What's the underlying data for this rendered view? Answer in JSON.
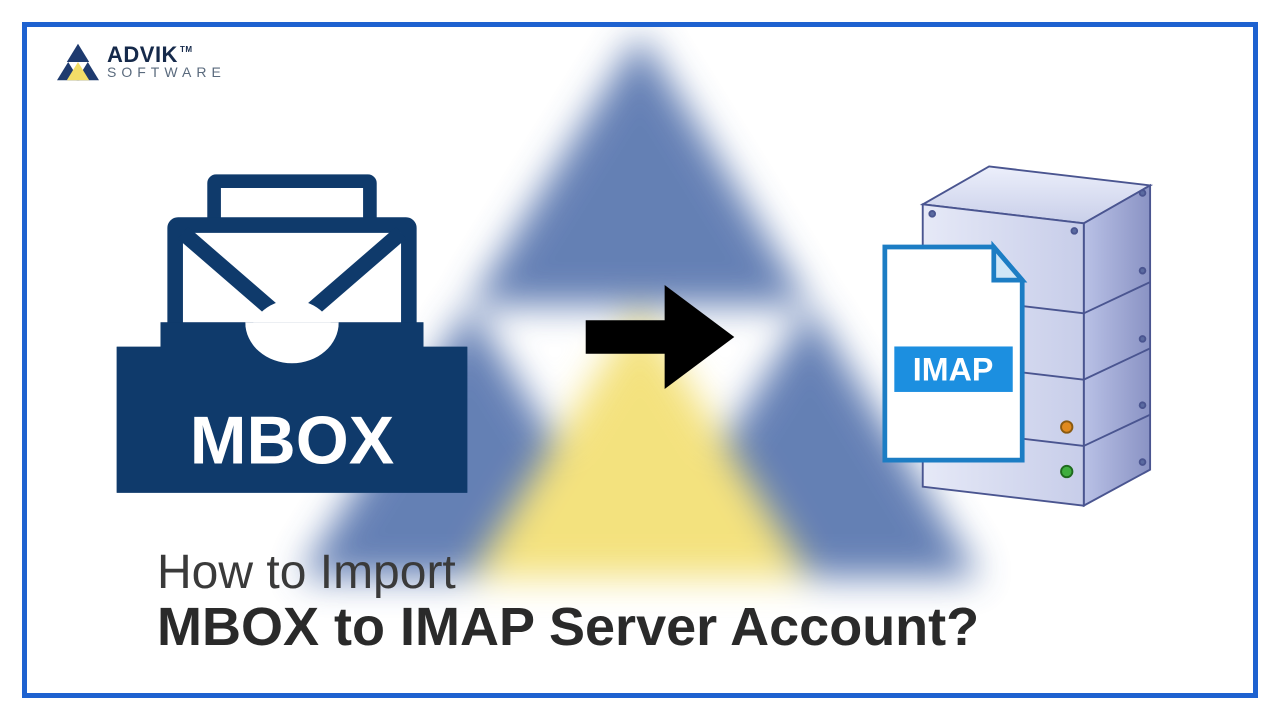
{
  "brand": {
    "name": "ADVIK",
    "subline": "SOFTWARE",
    "tm": "TM"
  },
  "mbox": {
    "label": "MBOX"
  },
  "imap": {
    "label": "IMAP"
  },
  "caption": {
    "line1": "How to Import",
    "line2": "MBOX to IMAP Server Account?"
  }
}
